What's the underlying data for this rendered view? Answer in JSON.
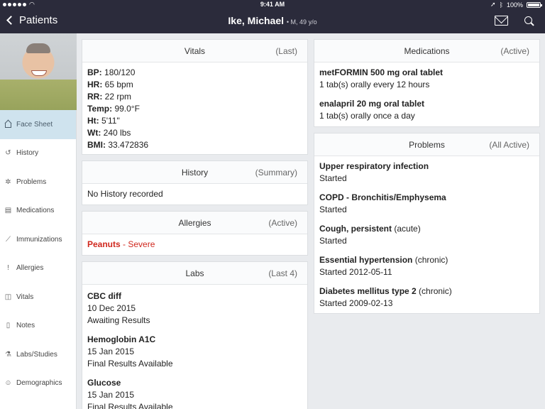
{
  "status_bar": {
    "time": "9:41 AM",
    "battery": "100%"
  },
  "nav": {
    "back_label": "Patients",
    "patient_name": "Ike, Michael",
    "patient_meta": "• M, 49 y/o"
  },
  "sidebar": {
    "items": [
      {
        "label": "Face Sheet",
        "icon": "home-icon",
        "active": true
      },
      {
        "label": "History",
        "icon": "history-icon"
      },
      {
        "label": "Problems",
        "icon": "gear-icon"
      },
      {
        "label": "Medications",
        "icon": "pill-bottle-icon"
      },
      {
        "label": "Immunizations",
        "icon": "syringe-icon"
      },
      {
        "label": "Allergies",
        "icon": "exclamation-icon"
      },
      {
        "label": "Vitals",
        "icon": "pulse-icon"
      },
      {
        "label": "Notes",
        "icon": "notes-icon"
      },
      {
        "label": "Labs/Studies",
        "icon": "flask-icon"
      },
      {
        "label": "Demographics",
        "icon": "person-icon"
      }
    ]
  },
  "vitals": {
    "title": "Vitals",
    "tag": "(Last)",
    "rows": [
      {
        "label": "BP:",
        "value": "180/120"
      },
      {
        "label": "HR:",
        "value": "65 bpm"
      },
      {
        "label": "RR:",
        "value": "22 rpm"
      },
      {
        "label": "Temp:",
        "value": "99.0°F"
      },
      {
        "label": "Ht:",
        "value": "5'11\""
      },
      {
        "label": "Wt:",
        "value": "240 lbs"
      },
      {
        "label": "BMI:",
        "value": "33.472836"
      }
    ]
  },
  "history": {
    "title": "History",
    "tag": "(Summary)",
    "text": "No History recorded"
  },
  "allergies": {
    "title": "Allergies",
    "tag": "(Active)",
    "allergen": "Peanuts",
    "severity": " - Severe"
  },
  "labs": {
    "title": "Labs",
    "tag": "(Last 4)",
    "items": [
      {
        "name": "CBC diff",
        "date": "10 Dec 2015",
        "status": "Awaiting Results"
      },
      {
        "name": "Hemoglobin A1C",
        "date": "15 Jan 2015",
        "status": "Final Results Available"
      },
      {
        "name": "Glucose",
        "date": "15 Jan 2015",
        "status": "Final Results Available"
      }
    ]
  },
  "medications": {
    "title": "Medications",
    "tag": "(Active)",
    "items": [
      {
        "name": "metFORMIN 500 mg oral tablet",
        "sig": "1 tab(s) orally every 12 hours"
      },
      {
        "name": "enalapril 20 mg oral tablet",
        "sig": "1 tab(s) orally once a day"
      }
    ]
  },
  "problems": {
    "title": "Problems",
    "tag": "(All Active)",
    "items": [
      {
        "name": "Upper respiratory infection",
        "qualifier": "",
        "status": "Started"
      },
      {
        "name": "COPD - Bronchitis/Emphysema",
        "qualifier": "",
        "status": "Started"
      },
      {
        "name": "Cough, persistent",
        "qualifier": " (acute)",
        "status": "Started"
      },
      {
        "name": "Essential hypertension",
        "qualifier": " (chronic)",
        "status": "Started 2012-05-11"
      },
      {
        "name": "Diabetes mellitus type 2",
        "qualifier": " (chronic)",
        "status": "Started 2009-02-13"
      }
    ]
  }
}
